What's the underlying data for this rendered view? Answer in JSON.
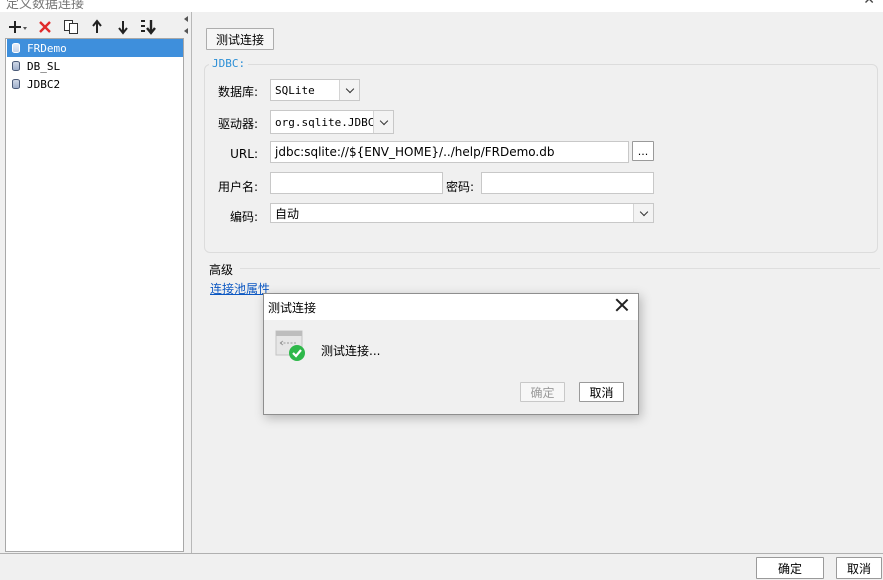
{
  "window": {
    "title": "定义数据连接"
  },
  "toolbar": {
    "icons": [
      "plus-dropdown-icon",
      "delete-x-icon",
      "copy-icon",
      "move-up-icon",
      "move-down-icon",
      "sort-icon"
    ]
  },
  "connections": [
    {
      "label": "FRDemo",
      "selected": true
    },
    {
      "label": "DB_SL",
      "selected": false
    },
    {
      "label": "JDBC2",
      "selected": false
    }
  ],
  "form": {
    "test_button": "测试连接",
    "group_title": "JDBC:",
    "database_label": "数据库:",
    "database_value": "SQLite",
    "driver_label": "驱动器:",
    "driver_value": "org.sqlite.JDBC",
    "url_label": "URL:",
    "url_value": "jdbc:sqlite://${ENV_HOME}/../help/FRDemo.db",
    "url_browse": "...",
    "username_label": "用户名:",
    "username_value": "",
    "password_label": "密码:",
    "password_value": "",
    "encoding_label": "编码:",
    "encoding_value": "自动",
    "advanced_label": "高级",
    "pool_link": "连接池属性"
  },
  "footer": {
    "ok": "确定",
    "cancel": "取消"
  },
  "dialog": {
    "title": "测试连接",
    "message": "测试连接...",
    "ok": "确定",
    "cancel": "取消",
    "icon": "connection-success-icon"
  },
  "colors": {
    "selection": "#3e8fdc",
    "group_title": "#2b8fd6",
    "link": "#0b57c2",
    "success": "#2eb84a"
  }
}
